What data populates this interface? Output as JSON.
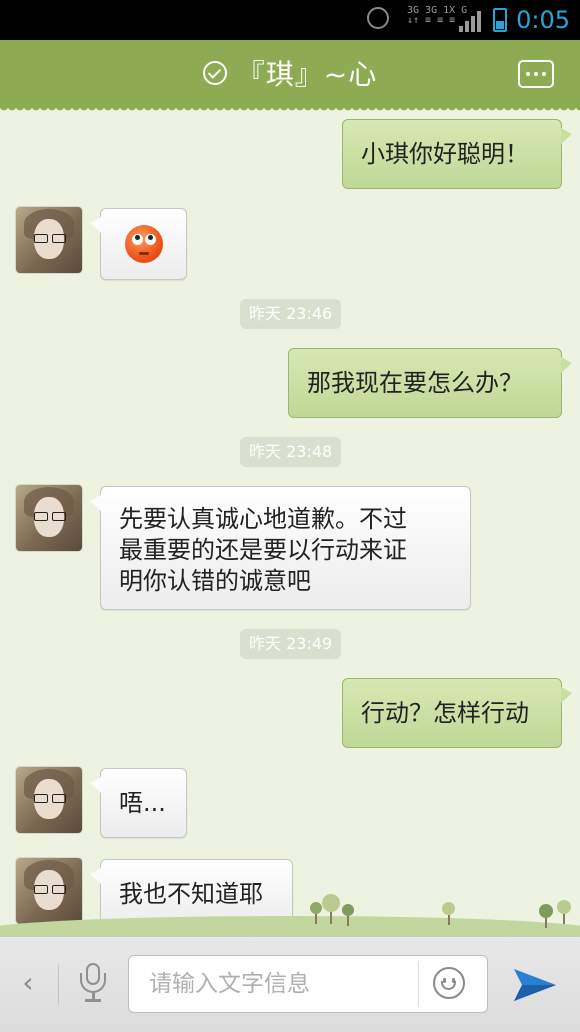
{
  "status_bar": {
    "network_line1": "3G 3G 1X  G",
    "network_line2": "↓↑ ≡ ≡  ≡",
    "time": "0:05"
  },
  "header": {
    "title": "『琪』~心",
    "status_icon": "check-circle-icon",
    "menu_icon": "more-dots-icon"
  },
  "messages": [
    {
      "direction": "out",
      "text": "小琪你好聪明！"
    },
    {
      "direction": "in",
      "emoji": "rolling-eyes-face"
    },
    {
      "timestamp": "昨天 23:46"
    },
    {
      "direction": "out",
      "text": "那我现在要怎么办？"
    },
    {
      "timestamp": "昨天 23:48"
    },
    {
      "direction": "in",
      "lines": [
        "先要认真诚心地道歉。不过",
        "最重要的还是要以行动来证",
        "明你认错的诚意吧"
      ]
    },
    {
      "timestamp": "昨天 23:49"
    },
    {
      "direction": "out",
      "text": "行动？怎样行动"
    },
    {
      "direction": "in",
      "text": "唔..."
    },
    {
      "direction": "in",
      "text": "我也不知道耶"
    }
  ],
  "input_bar": {
    "placeholder": "请输入文字信息",
    "back_icon": "chevron-left-icon",
    "voice_icon": "microphone-icon",
    "emoji_icon": "smiley-icon",
    "send_icon": "send-arrow-icon"
  },
  "colors": {
    "header": "#8cab52",
    "background": "#eef2e0",
    "outgoing_bubble": "#c9df9f",
    "incoming_bubble": "#ffffff",
    "timestamp_bg": "#dadfd0",
    "status_accent": "#2aa3d8",
    "send_accent": "#2a7fd0"
  }
}
